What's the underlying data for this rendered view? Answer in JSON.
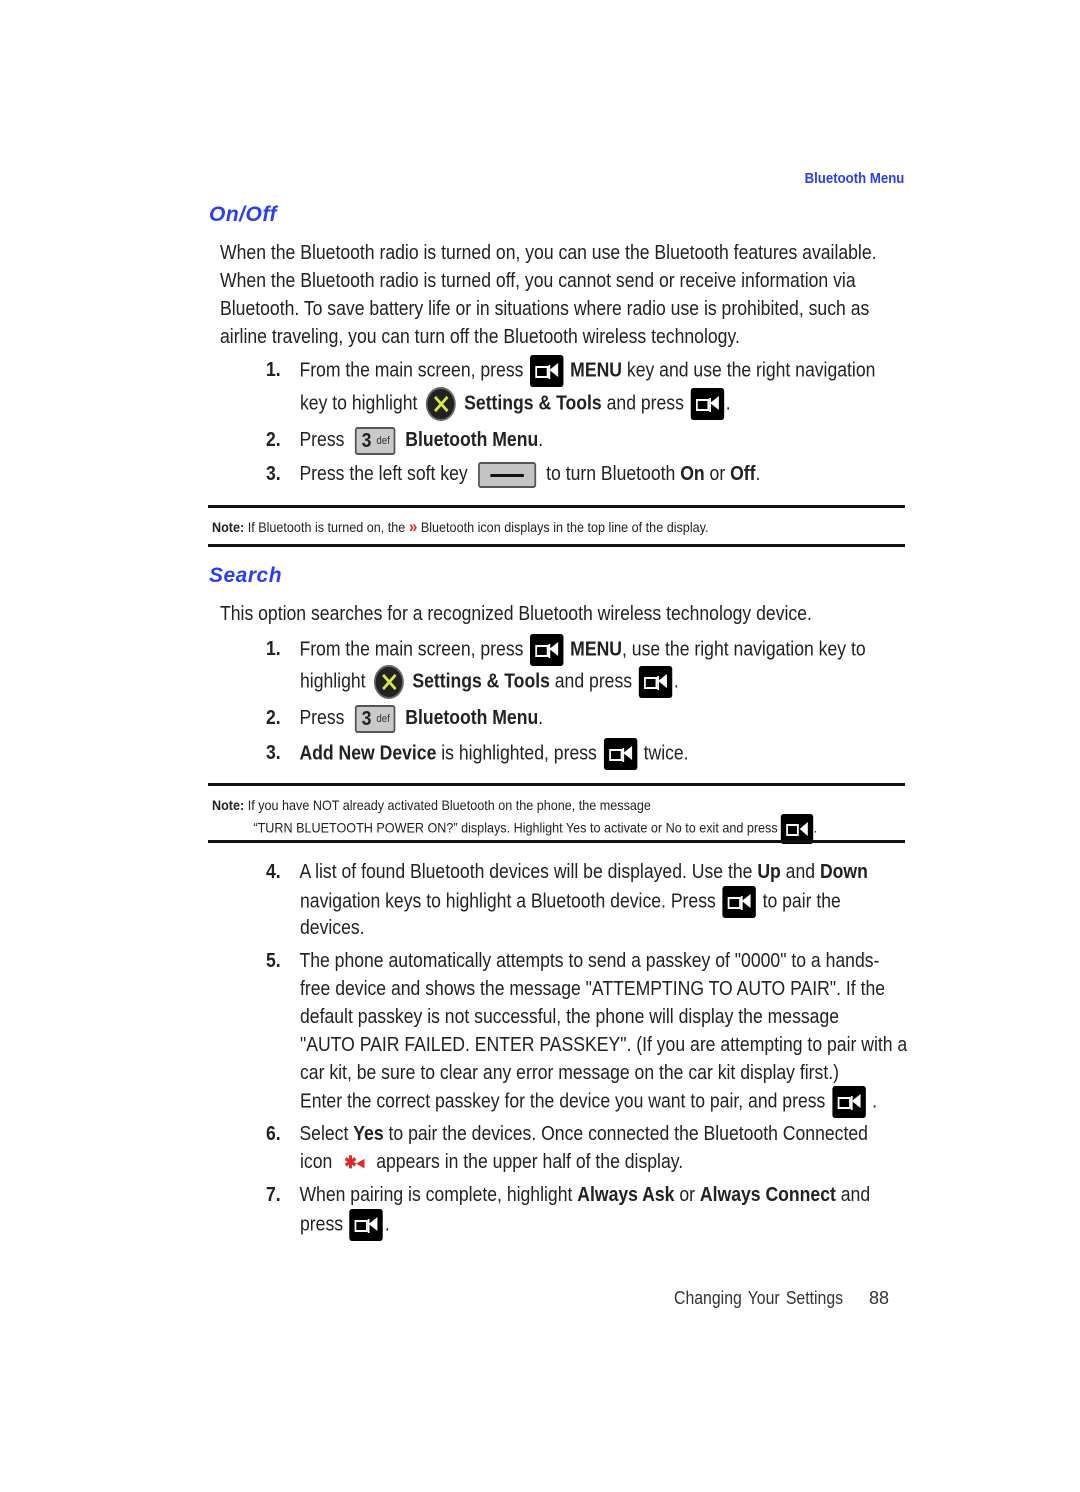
{
  "running_head": "Bluetooth Menu",
  "sections": {
    "onoff": {
      "title": "On/Off",
      "intro": [
        "When the Bluetooth radio is turned on, you can use the Bluetooth features available.",
        "When the Bluetooth radio is turned off, you cannot send or receive information via",
        "Bluetooth. To save battery life or in situations where radio use is prohibited, such as",
        "airline traveling, you can turn off the Bluetooth wireless technology."
      ],
      "step1": {
        "num": "1.",
        "a": "From the main screen, press",
        "b": "MENU",
        "c": "key and use the right navigation",
        "d": "key to highlight",
        "e": "Settings & Tools",
        "f": "and press",
        "g": "."
      },
      "step2": {
        "num": "2.",
        "a": "Press",
        "b": "Bluetooth Menu",
        "c": "."
      },
      "step3": {
        "num": "3.",
        "a": "Press the left soft key",
        "b": "to turn Bluetooth",
        "c": "On",
        "d": "or",
        "e": "Off",
        "f": "."
      },
      "note": {
        "label": "Note:",
        "a": "If Bluetooth is turned on, the",
        "b": "Bluetooth icon displays in the top line of the display."
      }
    },
    "search": {
      "title": "Search",
      "intro": "This option searches for a recognized Bluetooth wireless technology device.",
      "step1": {
        "num": "1.",
        "a": "From the main screen, press",
        "b": "MENU",
        "c": ", use the right navigation key to",
        "d": "highlight",
        "e": "Settings & Tools",
        "f": "and press",
        "g": "."
      },
      "step2": {
        "num": "2.",
        "a": "Press",
        "b": "Bluetooth Menu",
        "c": "."
      },
      "step3": {
        "num": "3.",
        "a": "Add New Device",
        "b": "is highlighted, press",
        "c": "twice."
      },
      "note": {
        "label": "Note:",
        "line1": "If you have NOT already activated Bluetooth on the phone, the message",
        "line2": "“TURN BLUETOOTH POWER ON?” displays. Highlight Yes to activate or No to exit and press",
        "end": "."
      },
      "step4": {
        "num": "4.",
        "l1a": "A list of found Bluetooth devices will be displayed. Use the",
        "up": "Up",
        "and": "and",
        "down": "Down",
        "l2a": "navigation keys to highlight a Bluetooth device. Press",
        "l2b": "to pair the",
        "l3": "devices."
      },
      "step5": {
        "num": "5.",
        "lines": [
          "The phone automatically attempts to send a passkey of \"0000\" to a hands-",
          "free device and shows the message \"ATTEMPTING TO AUTO PAIR\". If the",
          "default passkey is not successful, the phone will display the message",
          "\"AUTO PAIR FAILED. ENTER PASSKEY\". (If you are attempting to pair with a",
          "car kit, be sure to clear any error message on the car kit display first.)"
        ],
        "last": "Enter the correct passkey for the device you want to pair, and press",
        "end": "."
      },
      "step6": {
        "num": "6.",
        "a": "Select",
        "b": "Yes",
        "c": "to pair the devices. Once connected the Bluetooth Connected",
        "d": "icon",
        "e": "appears in the upper half of the display."
      },
      "step7": {
        "num": "7.",
        "a": "When pairing is complete, highlight",
        "b": "Always Ask",
        "c": "or",
        "d": "Always Connect",
        "e": "and",
        "f": "press",
        "g": "."
      }
    }
  },
  "icons": {
    "ok_key": "OK",
    "key3_digit": "3",
    "key3_letters": "def",
    "bt_icon": "»",
    "bt_connected_icon": "✱◂"
  },
  "footer": {
    "chapter": "Changing Your Settings",
    "page": "88"
  }
}
